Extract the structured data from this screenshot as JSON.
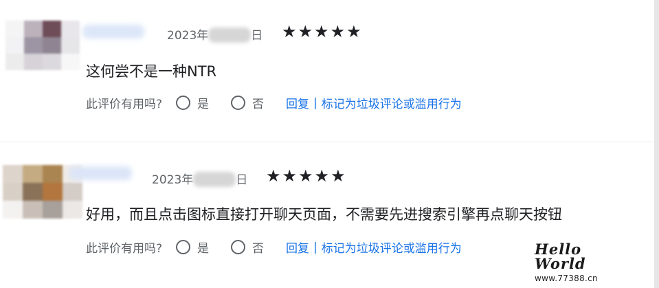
{
  "reviews": [
    {
      "date_prefix": "2023年",
      "date_suffix": "日",
      "stars": "★★★★★",
      "rating": 5,
      "text": "这何尝不是一种NTR",
      "helpful_prompt": "此评价有用吗?",
      "yes_label": "是",
      "no_label": "否",
      "reply_label": "回复",
      "separator": "|",
      "report_label": "标记为垃圾评论或滥用行为",
      "avatar_colors": [
        "#f4f4f4",
        "#bcb2bc",
        "#6e4c58",
        "#e8e6ea",
        "#f2f1f3",
        "#9d95a4",
        "#8f8592",
        "#e6e5e8",
        "#ececec",
        "#d6d2d8",
        "#dcd9de",
        "#f7f7f7"
      ]
    },
    {
      "date_prefix": "2023年",
      "date_suffix": "日",
      "stars": "★★★★★",
      "rating": 5,
      "text": "好用，而且点击图标直接打开聊天页面，不需要先进搜索引擎再点聊天按钮",
      "helpful_prompt": "此评价有用吗?",
      "yes_label": "是",
      "no_label": "否",
      "reply_label": "回复",
      "separator": "|",
      "report_label": "标记为垃圾评论或滥用行为",
      "avatar_colors": [
        "#ddd4cb",
        "#c4ab82",
        "#ab8551",
        "#f1ece8",
        "#d8d0c6",
        "#8a7258",
        "#b2763e",
        "#d4ccc6",
        "#f4f2f0",
        "#c9bfb8",
        "#a8a09a",
        "#ebe8e6"
      ]
    }
  ],
  "watermark": {
    "title": "Hello World",
    "url": "www.77388.cn"
  }
}
